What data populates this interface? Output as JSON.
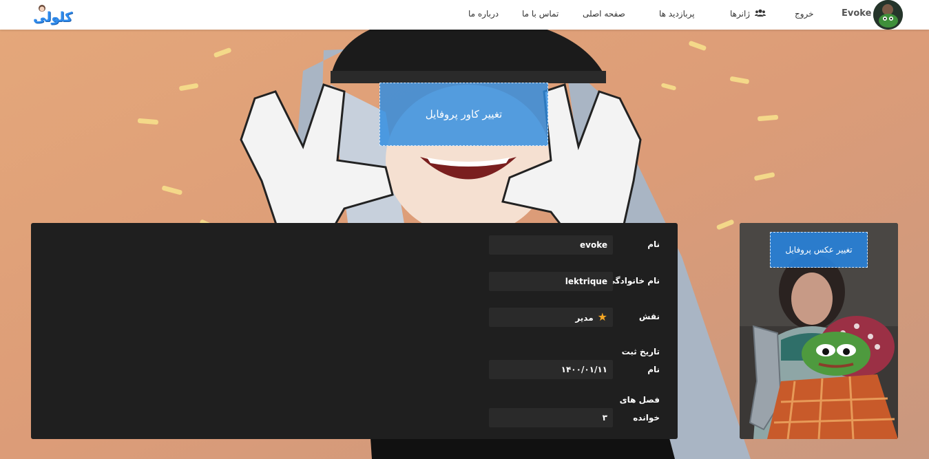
{
  "nav": {
    "username": "Evoke",
    "logout": "خروج",
    "genres": "ژانرها",
    "most_viewed": "پربازدید ها",
    "home": "صفحه اصلی",
    "contact": "تماس با ما",
    "about": "درباره ما",
    "logo_text": "کلولی"
  },
  "cover": {
    "change_button": "تغییر کاور پروفایل"
  },
  "profile_photo": {
    "change_button": "تغییر عکس پروفایل"
  },
  "profile": {
    "first_name": {
      "label": "نام",
      "value": "evoke"
    },
    "last_name": {
      "label": "نام خانوادگی",
      "value": "lektrique"
    },
    "role": {
      "label": "نقش",
      "value": "مدیر",
      "icon": "star-icon"
    },
    "registered": {
      "label_line1": "تاریخ ثبت",
      "label_line2": "نام",
      "value": "۱۴۰۰/۰۱/۱۱"
    },
    "chapters_read": {
      "label_line1": "فصل های",
      "label_line2": "خوانده",
      "value": "۳"
    }
  },
  "colors": {
    "accent_blue": "#2f8bec",
    "panel_bg": "#1f1f1f",
    "field_bg": "#2a2a2a",
    "star": "#f5a623"
  }
}
